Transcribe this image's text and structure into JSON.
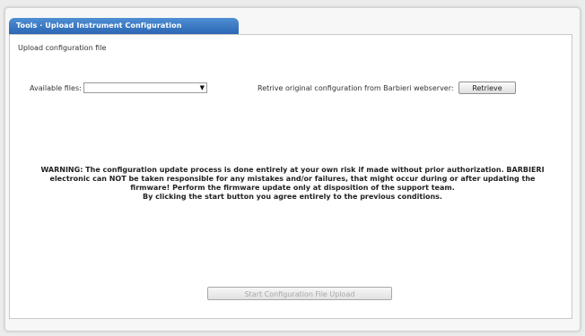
{
  "tab": {
    "title": "Tools · Upload Instrument Configuration"
  },
  "section": {
    "label": "Upload configuration file"
  },
  "files": {
    "label": "Available files:",
    "selected_value": ""
  },
  "retrieve": {
    "label": "Retrive original configuration from Barbieri webserver:",
    "button_label": "Retrieve"
  },
  "warning": {
    "line1": "WARNING: The configuration update process is done entirely at your own risk if made without prior authorization. BARBIERI",
    "line2": "electronic can NOT be taken responsible for any mistakes and/or failures, that might occur during or after updating the",
    "line3": "firmware! Perform the firmware update only at disposition of the support team.",
    "line4": "By clicking the start button you agree entirely to the previous conditions."
  },
  "start": {
    "button_label": "Start Configuration File Upload",
    "enabled": false
  },
  "icons": {
    "dropdown": "chevron-down-icon"
  }
}
